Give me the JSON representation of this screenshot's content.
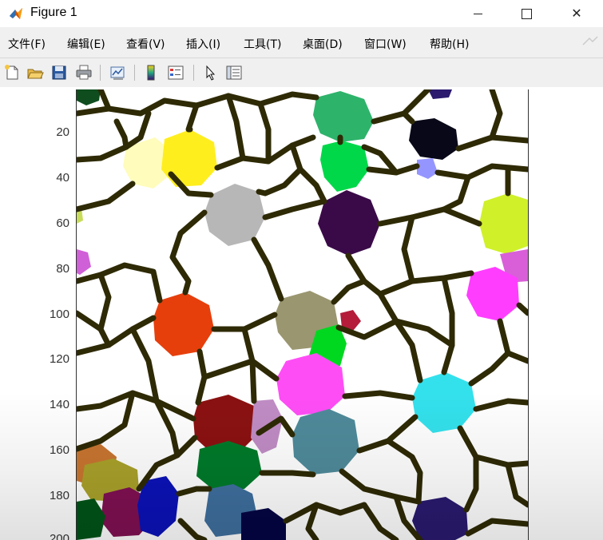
{
  "window": {
    "title": "Figure 1",
    "controls": {
      "minimize": "—",
      "maximize": "☐",
      "close": "✕"
    }
  },
  "menubar": {
    "items": [
      {
        "label": "文件(F)"
      },
      {
        "label": "编辑(E)"
      },
      {
        "label": "查看(V)"
      },
      {
        "label": "插入(I)"
      },
      {
        "label": "工具(T)"
      },
      {
        "label": "桌面(D)"
      },
      {
        "label": "窗口(W)"
      },
      {
        "label": "帮助(H)"
      }
    ]
  },
  "toolbar": {
    "buttons": [
      {
        "icon": "new-figure-icon"
      },
      {
        "icon": "open-file-icon"
      },
      {
        "icon": "save-icon"
      },
      {
        "icon": "print-icon"
      },
      {
        "icon": "link-plot-icon"
      },
      {
        "icon": "colorbar-icon"
      },
      {
        "icon": "legend-icon"
      },
      {
        "icon": "pointer-icon"
      },
      {
        "icon": "property-inspector-icon"
      }
    ]
  },
  "plot": {
    "y_ticks": [
      "20",
      "40",
      "60",
      "80",
      "100",
      "120",
      "140",
      "160",
      "180",
      "200"
    ],
    "colors": {
      "boundary": "#2e2a05",
      "background": "#ffffff"
    }
  }
}
